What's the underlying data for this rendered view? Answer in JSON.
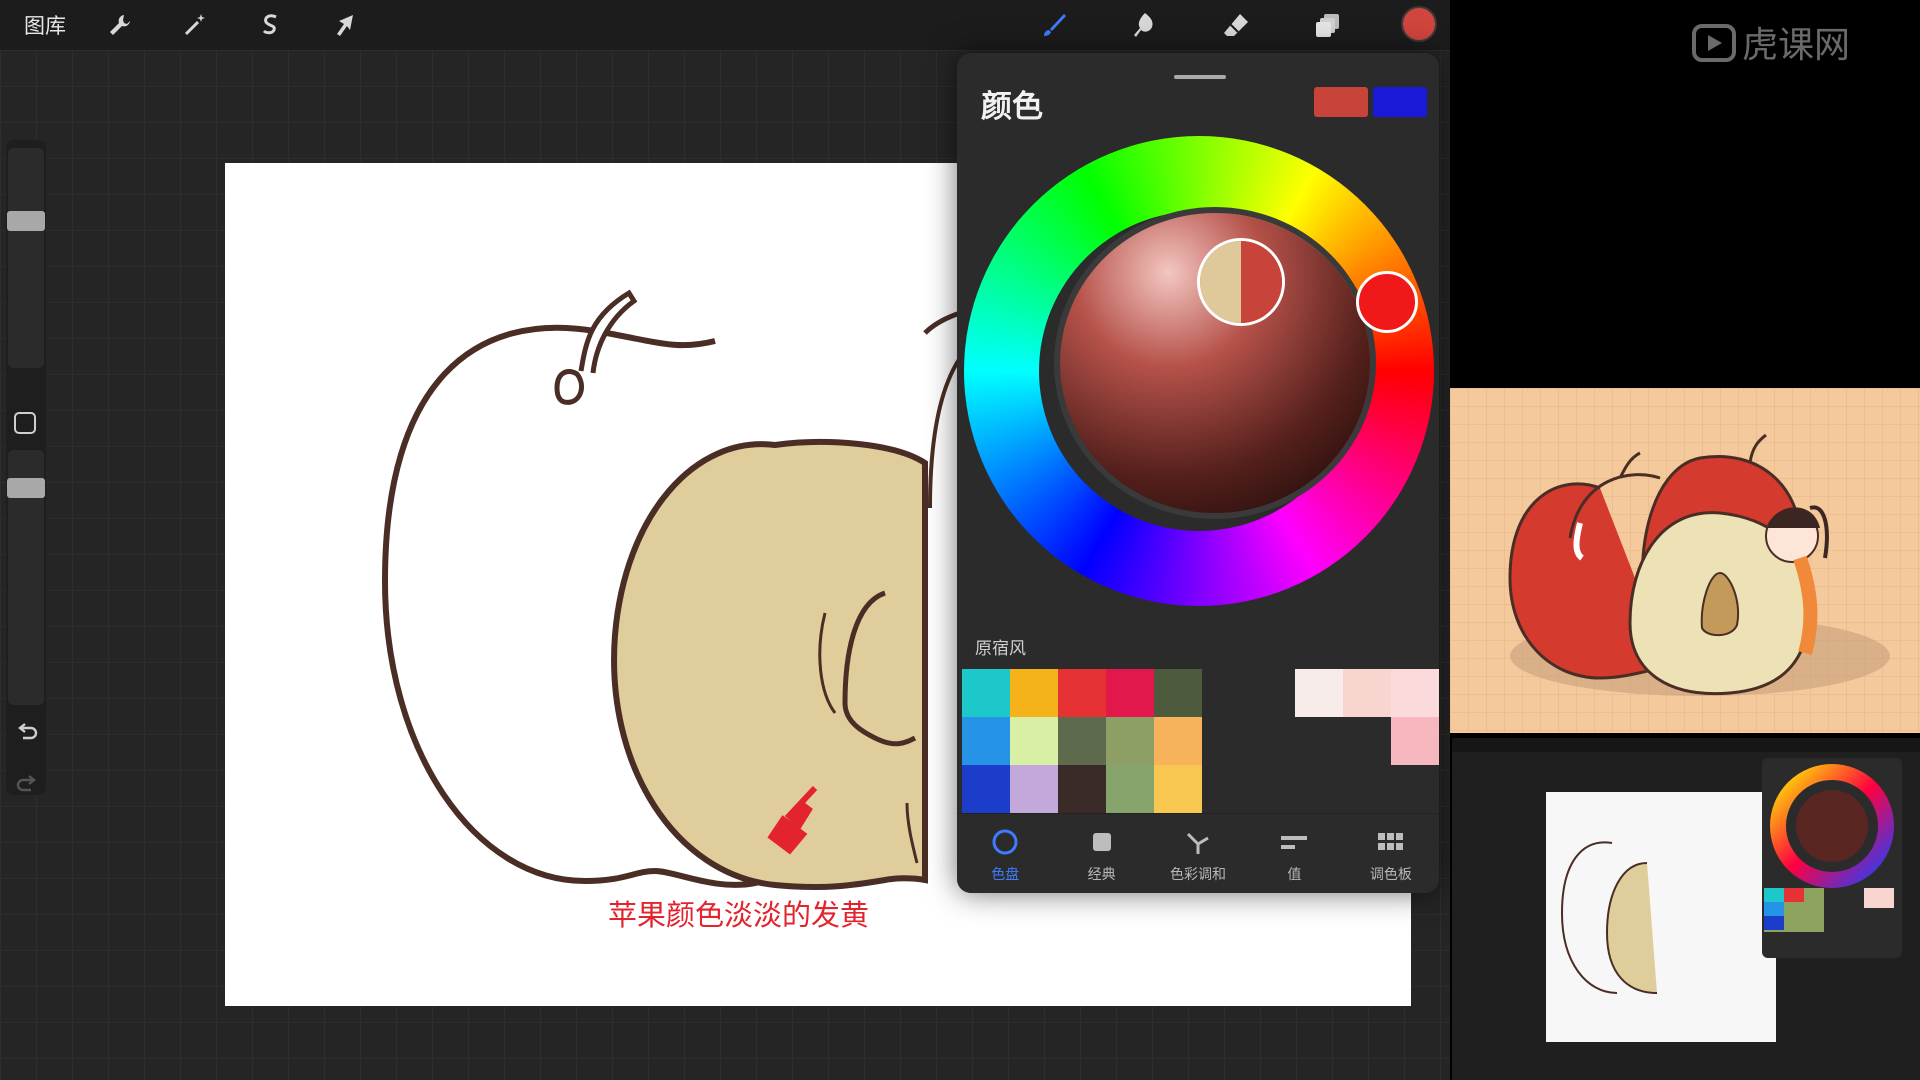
{
  "toolbar": {
    "gallery_label": "图库",
    "current_color": "#d0453d",
    "icons": [
      "wrench-icon",
      "magic-wand-icon",
      "selection-icon",
      "transform-arrow-icon",
      "brush-icon",
      "smudge-icon",
      "eraser-icon",
      "layers-icon"
    ]
  },
  "color_panel": {
    "title": "颜色",
    "primary_color": "#c8443b",
    "secondary_color": "#1a1ad8",
    "picker_new_color": "#dfc89a",
    "picker_old_color": "#c8443b",
    "palette_name": "原宿风",
    "palette": [
      "#1cc8c9",
      "#f5b21b",
      "#e63235",
      "#e2174c",
      "#4d5a3c",
      "#2594e6",
      "#d7f0a5",
      "#5e6a4c",
      "#8d9f64",
      "#f7b35b",
      "#1c3dc9",
      "#c3a8dc",
      "#3a2a28",
      "#87a46c",
      "#f7c750"
    ],
    "palette_right": [
      "#f8ecea",
      "#f8d6cf",
      "#fadada",
      "#f6b8be"
    ],
    "tabs": [
      {
        "label": "色盘",
        "icon": "disc-icon",
        "active": true
      },
      {
        "label": "经典",
        "icon": "square-icon",
        "active": false
      },
      {
        "label": "色彩调和",
        "icon": "harmony-icon",
        "active": false
      },
      {
        "label": "值",
        "icon": "value-sliders-icon",
        "active": false
      },
      {
        "label": "调色板",
        "icon": "grid-icon",
        "active": false
      }
    ]
  },
  "canvas": {
    "annotation": "苹果颜色淡淡的发黄",
    "apple_fill": "#e0cd9c",
    "outline_color": "#4a2e25"
  }
}
